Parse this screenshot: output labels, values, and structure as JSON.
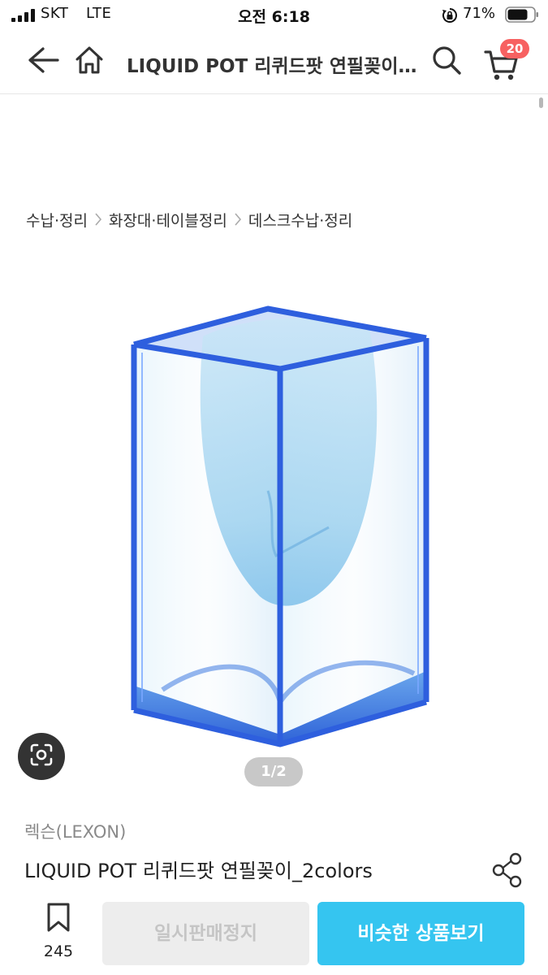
{
  "status_bar": {
    "carrier": "SKT",
    "network": "LTE",
    "time": "오전 6:18",
    "battery_percent": "71%",
    "icons": [
      "signal-icon",
      "orientation-lock-icon",
      "battery-icon"
    ]
  },
  "header": {
    "title": "LIQUID POT 리퀴드팟 연필꽂이_2colors",
    "cart_count": "20",
    "icons": [
      "back-arrow-icon",
      "home-icon",
      "search-icon",
      "cart-icon"
    ]
  },
  "breadcrumb": {
    "items": [
      "수납·정리",
      "화장대·테이블정리",
      "데스크수납·정리"
    ]
  },
  "gallery": {
    "pager": "1/2",
    "icons": [
      "lens-search-icon"
    ]
  },
  "product": {
    "brand": "렉슨(LEXON)",
    "name": "LIQUID POT 리퀴드팟 연필꽂이_2colors",
    "icons": [
      "share-icon"
    ]
  },
  "bottom_bar": {
    "wish_count": "245",
    "soldout_label": "일시판매정지",
    "similar_label": "비슷한 상품보기",
    "icons": [
      "bookmark-icon"
    ]
  },
  "colors": {
    "accent": "#35c5f0",
    "badge": "#f76161",
    "disabled_bg": "#ededed",
    "disabled_text": "#c5c5c5"
  }
}
